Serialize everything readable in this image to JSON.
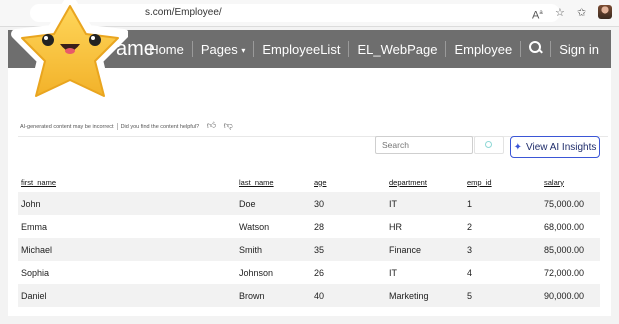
{
  "browser": {
    "url": "s.com/Employee/",
    "read_aloud_icon": "read-aloud-icon",
    "favorite_icon": "star-outline-icon",
    "favorites_bar_icon": "favorites-icon"
  },
  "site": {
    "brand_partial": "ame",
    "nav": {
      "home": "Home",
      "pages": "Pages",
      "pages_caret": "▾",
      "employee_list": "EmployeeList",
      "el_webpage": "EL_WebPage",
      "employee": "Employee",
      "sign_in": "Sign in"
    }
  },
  "ai_feedback": {
    "disclaimer": "AI-generated content may be incorrect",
    "question": "Did you find the content helpful?",
    "thumbs_up_icon": "thumbs-up-icon",
    "thumbs_down_icon": "thumbs-down-icon"
  },
  "toolbar": {
    "search_placeholder": "Search",
    "ai_button_label": "View AI Insights",
    "ai_button_icon": "sparkle-icon"
  },
  "table": {
    "columns": [
      "first_name",
      "last_name",
      "age",
      "department",
      "emp_id",
      "salary"
    ],
    "rows": [
      [
        "John",
        "Doe",
        "30",
        "IT",
        "1",
        "75,000.00"
      ],
      [
        "Emma",
        "Watson",
        "28",
        "HR",
        "2",
        "68,000.00"
      ],
      [
        "Michael",
        "Smith",
        "35",
        "Finance",
        "3",
        "85,000.00"
      ],
      [
        "Sophia",
        "Johnson",
        "26",
        "IT",
        "4",
        "72,000.00"
      ],
      [
        "Daniel",
        "Brown",
        "40",
        "Marketing",
        "5",
        "90,000.00"
      ]
    ]
  },
  "colors": {
    "nav_bg": "#6e6e6e",
    "accent": "#3b56d6",
    "row_alt": "#f2f2f2",
    "star": "#f6c33a"
  }
}
